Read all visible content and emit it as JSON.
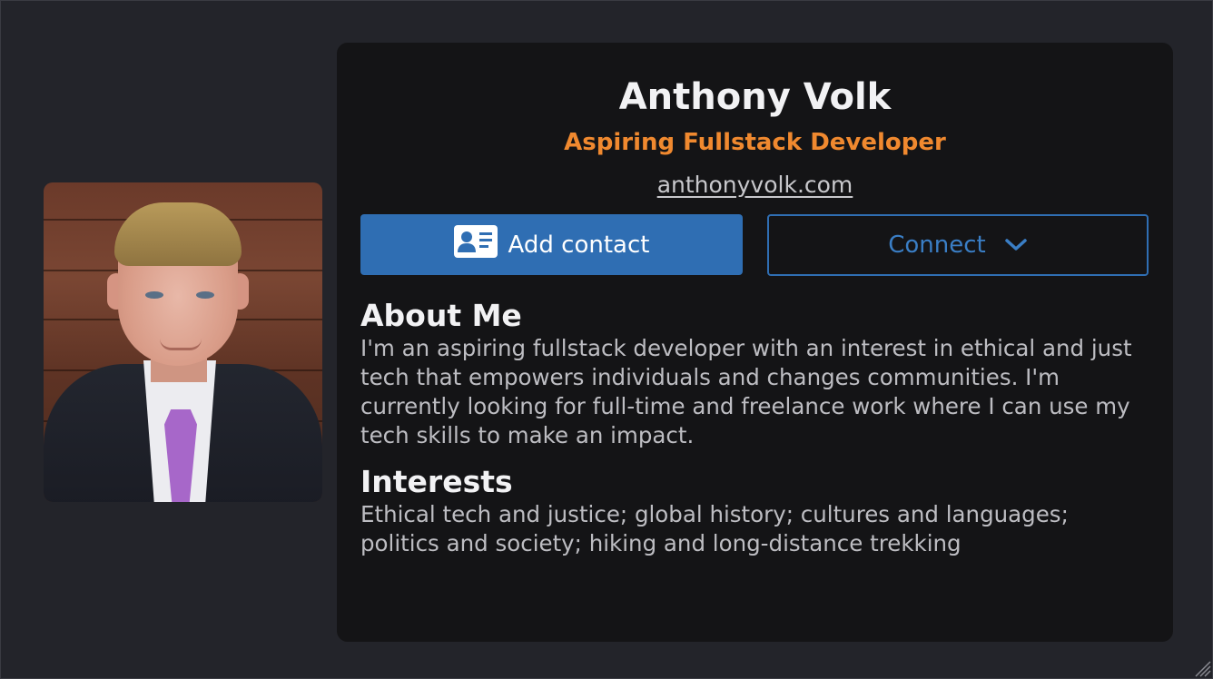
{
  "profile": {
    "name": "Anthony Volk",
    "role": "Aspiring Fullstack Developer",
    "website": "anthonyvolk.com"
  },
  "actions": {
    "add_contact_label": "Add contact",
    "add_contact_icon": "contact-card-icon",
    "connect_label": "Connect",
    "connect_icon": "chevron-down-icon"
  },
  "about": {
    "title": "About Me",
    "text": "I'm an aspiring fullstack developer with an interest in ethical and just tech that empowers individuals and changes communities. I'm currently looking for full-time and freelance work where I can use my tech skills to make an impact."
  },
  "interests": {
    "title": "Interests",
    "text": "Ethical tech and justice; global history; cultures and languages; politics and society; hiking and long-distance trekking"
  },
  "colors": {
    "background": "#23242a",
    "card": "#141416",
    "accent": "#f0892f",
    "button_blue": "#2f6eb3"
  }
}
